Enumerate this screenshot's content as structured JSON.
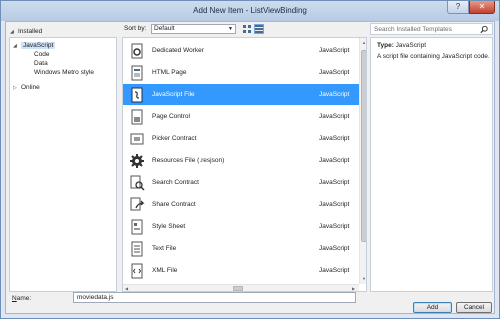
{
  "window": {
    "title": "Add New Item - ListViewBinding",
    "help_label": "?",
    "close_label": "✕"
  },
  "left_tree": {
    "header": "Installed",
    "nodes": [
      {
        "label": "JavaScript",
        "expanded": true,
        "selected": true
      },
      {
        "label": "Code"
      },
      {
        "label": "Data"
      },
      {
        "label": "Windows Metro style"
      },
      {
        "label": "Online",
        "expanded": false
      }
    ]
  },
  "toolbar": {
    "sort_label": "Sort by:",
    "sort_value": "Default",
    "view_modes": [
      "medium-icons-view",
      "list-view"
    ]
  },
  "search": {
    "placeholder": "Search Installed Templates",
    "icon": "search-icon"
  },
  "templates": [
    {
      "name": "Dedicated Worker",
      "type": "JavaScript",
      "icon": "gear-doc-icon"
    },
    {
      "name": "HTML Page",
      "type": "JavaScript",
      "icon": "html-page-icon"
    },
    {
      "name": "JavaScript File",
      "type": "JavaScript",
      "icon": "js-file-icon",
      "selected": true
    },
    {
      "name": "Page Control",
      "type": "JavaScript",
      "icon": "page-control-icon"
    },
    {
      "name": "Picker Contract",
      "type": "JavaScript",
      "icon": "picker-icon"
    },
    {
      "name": "Resources File (.resjson)",
      "type": "JavaScript",
      "icon": "resources-gear-icon"
    },
    {
      "name": "Search Contract",
      "type": "JavaScript",
      "icon": "search-contract-icon"
    },
    {
      "name": "Share Contract",
      "type": "JavaScript",
      "icon": "share-contract-icon"
    },
    {
      "name": "Style Sheet",
      "type": "JavaScript",
      "icon": "style-sheet-icon"
    },
    {
      "name": "Text File",
      "type": "JavaScript",
      "icon": "text-file-icon"
    },
    {
      "name": "XML File",
      "type": "JavaScript",
      "icon": "xml-file-icon"
    }
  ],
  "details": {
    "type_label": "Type:",
    "type_value": "JavaScript",
    "description": "A script file containing JavaScript code."
  },
  "footer": {
    "name_label": "Name:",
    "name_value": "moviedata.js",
    "add_label": "Add",
    "cancel_label": "Cancel"
  },
  "colors": {
    "selection": "#3399ff",
    "title_bar": "#b7cbe4",
    "close_button": "#c2412d"
  }
}
